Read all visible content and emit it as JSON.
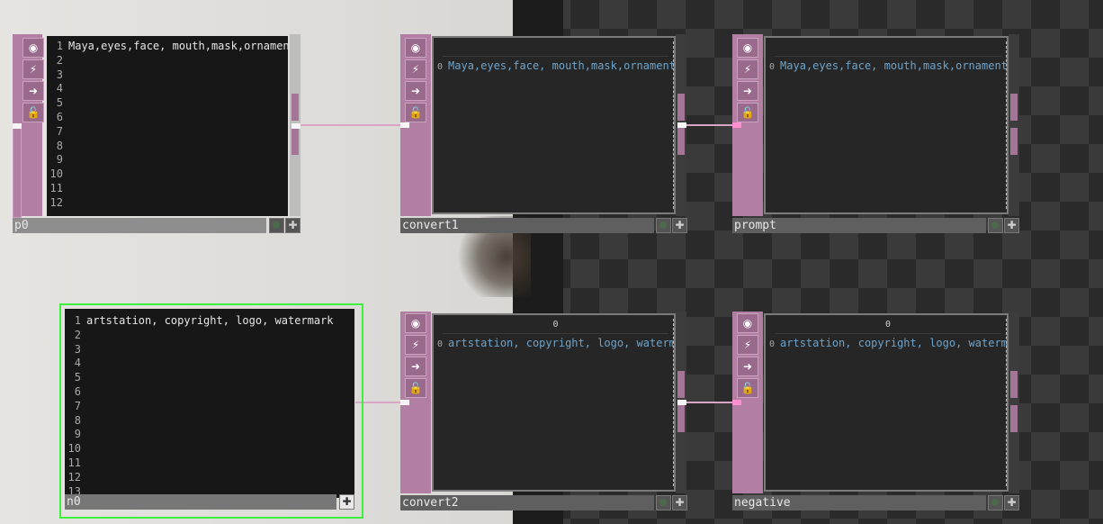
{
  "nodes": {
    "p0": {
      "name": "p0",
      "lines": [
        "Maya,eyes,face, mouth,mask,ornament",
        "",
        "",
        "",
        "",
        "",
        "",
        "",
        "",
        "",
        "",
        ""
      ]
    },
    "convert1": {
      "name": "convert1",
      "header": "",
      "row_index": "0",
      "cell": "Maya,eyes,face, mouth,mask,ornament"
    },
    "prompt": {
      "name": "prompt",
      "header": "",
      "row_index": "0",
      "cell": "Maya,eyes,face, mouth,mask,ornament"
    },
    "n0": {
      "name": "n0",
      "lines": [
        "artstation, copyright, logo, watermark",
        "",
        "",
        "",
        "",
        "",
        "",
        "",
        "",
        "",
        "",
        "",
        ""
      ]
    },
    "convert2": {
      "name": "convert2",
      "header": "0",
      "row_index": "0",
      "cell": "artstation, copyright, logo, watermark"
    },
    "negative": {
      "name": "negative",
      "header": "0",
      "row_index": "0",
      "cell": "artstation, copyright, logo, watermark"
    }
  },
  "icons": {
    "viewer": "◉",
    "bypass": "⚡",
    "export": "➜",
    "lock": "🔓",
    "add": "✚"
  },
  "colors": {
    "dat_node": "#b27ea3",
    "selected_outline": "#3df03d",
    "wire": "#d8a5c4",
    "cell_text": "#6fa3c9"
  }
}
